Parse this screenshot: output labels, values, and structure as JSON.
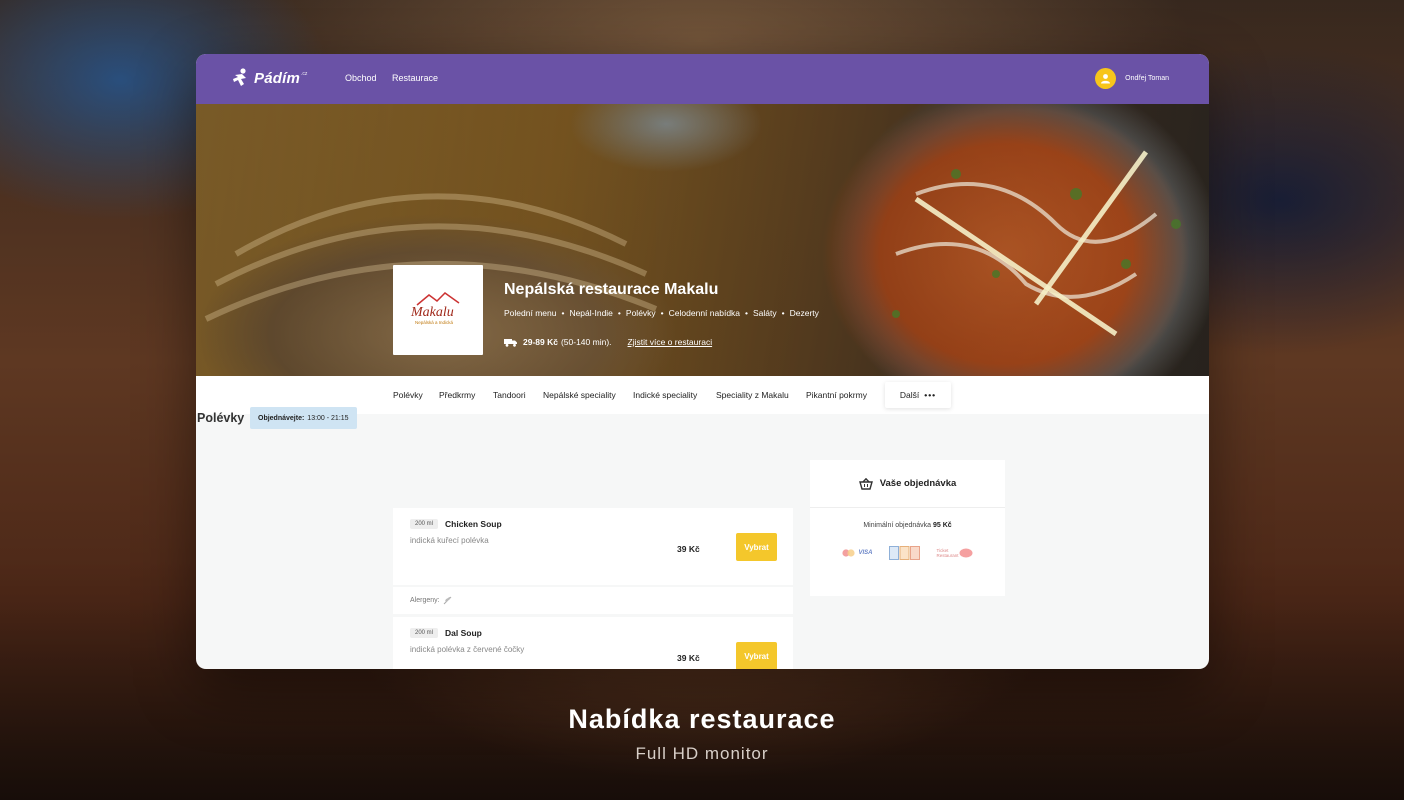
{
  "header": {
    "brand": "Pádím",
    "brand_suffix": ".cz",
    "nav": [
      "Obchod",
      "Restaurace"
    ],
    "user_name": "Ondřej Toman"
  },
  "restaurant": {
    "name": "Nepálská restaurace Makalu",
    "logo_text": "Makalu",
    "logo_subtext": "Nepálská a Indická Restaurace",
    "tags": [
      "Polední menu",
      "Nepál-Indie",
      "Polévky",
      "Celodenní nabídka",
      "Saláty",
      "Dezerty"
    ],
    "delivery_price": "29-89 Kč",
    "delivery_time": "(50-140 min).",
    "more_info": "Zjistit více o restauraci"
  },
  "categories": [
    "Polévky",
    "Předkrmy",
    "Tandoori",
    "Nepálské speciality",
    "Indické speciality",
    "Speciality z Makalu",
    "Pikantní pokrmy"
  ],
  "categories_more": "Další",
  "section": {
    "title": "Polévky",
    "order_label": "Objednávejte:",
    "order_hours": "13:00 - 21:15"
  },
  "items": [
    {
      "size": "200 ml",
      "name": "Chicken Soup",
      "desc": "indická kuřecí polévka",
      "price": "39 Kč",
      "button": "Vybrat"
    },
    {
      "size": "200 ml",
      "name": "Dal Soup",
      "desc": "indická polévka z červené čočky",
      "price": "39 Kč",
      "button": "Vybrat"
    }
  ],
  "allergens_label": "Alergeny:",
  "order": {
    "title": "Vaše objednávka",
    "min_label": "Minimální objednávka",
    "min_value": "95 Kč",
    "payments": [
      "VISA",
      "Ticket Restaurant"
    ]
  },
  "caption": {
    "title": "Nabídka restaurace",
    "subtitle": "Full HD monitor"
  },
  "colors": {
    "header_bg": "#6a52a6",
    "accent_yellow": "#f4c72b",
    "badge_blue": "#cfe4f3"
  }
}
